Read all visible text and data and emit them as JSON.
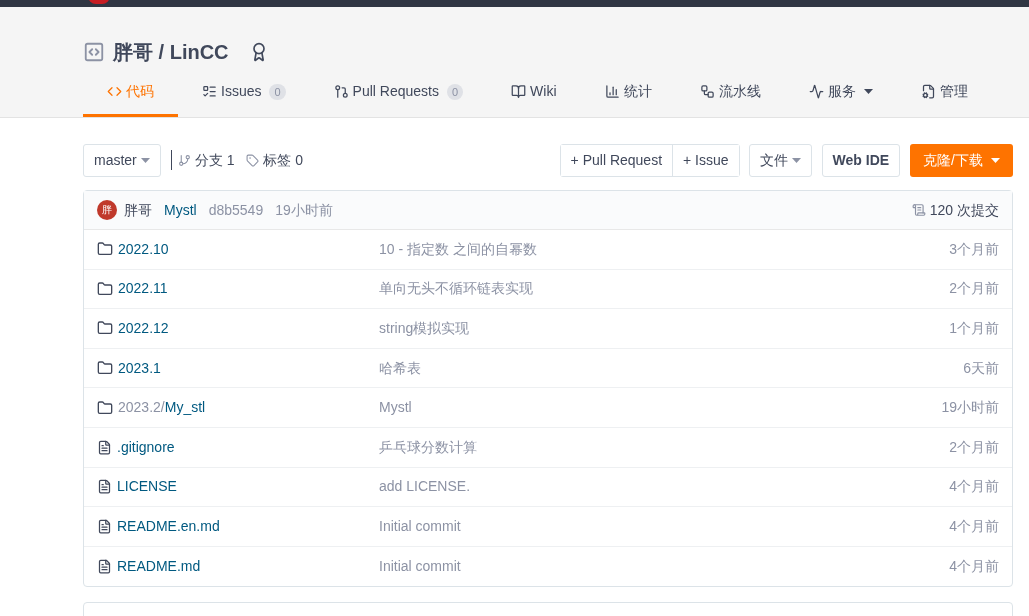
{
  "repo": {
    "owner": "胖哥",
    "separator": "/",
    "name": "LinCC"
  },
  "tabs": [
    {
      "kind": "code",
      "label": "代码",
      "selected": true
    },
    {
      "kind": "issues",
      "label": "Issues",
      "count": "0",
      "selected": false
    },
    {
      "kind": "pulls",
      "label": "Pull Requests",
      "count": "0",
      "selected": false
    },
    {
      "kind": "wiki",
      "label": "Wiki",
      "selected": false
    },
    {
      "kind": "stats",
      "label": "统计",
      "selected": false
    },
    {
      "kind": "pipeline",
      "label": "流水线",
      "selected": false
    },
    {
      "kind": "services",
      "label": "服务",
      "dropdown": true,
      "selected": false
    },
    {
      "kind": "manage",
      "label": "管理",
      "selected": false
    }
  ],
  "toolbar": {
    "branch": "master",
    "branches": "分支 1",
    "tags": "标签 0",
    "buttons": [
      "+ Pull Request",
      "+ Issue"
    ],
    "file_menu": "文件",
    "web_ide": "Web IDE",
    "clone": "克隆/下载"
  },
  "last_commit": {
    "avatar": "胖",
    "author": "胖哥",
    "message": "Mystl",
    "hash": "d8b5549",
    "time": "19小时前",
    "commits": "120 次提交"
  },
  "files": [
    {
      "kind": "folder",
      "name": "2022.10",
      "message": "10 - 指定数 之间的自幂数",
      "time": "3个月前"
    },
    {
      "kind": "folder",
      "name": "2022.11",
      "message": "单向无头不循环链表实现",
      "time": "2个月前"
    },
    {
      "kind": "folder",
      "name": "2022.12",
      "message": "string模拟实现",
      "time": "1个月前"
    },
    {
      "kind": "folder",
      "name": "2023.1",
      "message": "哈希表",
      "time": "6天前"
    },
    {
      "kind": "folder",
      "prefix": "2023.2/",
      "name": "My_stl",
      "message": "Mystl",
      "time": "19小时前"
    },
    {
      "kind": "file",
      "name": ".gitignore",
      "message": "乒乓球分数计算",
      "time": "2个月前"
    },
    {
      "kind": "file",
      "name": "LICENSE",
      "message": "add LICENSE.",
      "time": "4个月前"
    },
    {
      "kind": "file",
      "name": "README.en.md",
      "message": "Initial commit",
      "time": "4个月前"
    },
    {
      "kind": "file",
      "name": "README.md",
      "message": "Initial commit",
      "time": "4个月前"
    }
  ]
}
